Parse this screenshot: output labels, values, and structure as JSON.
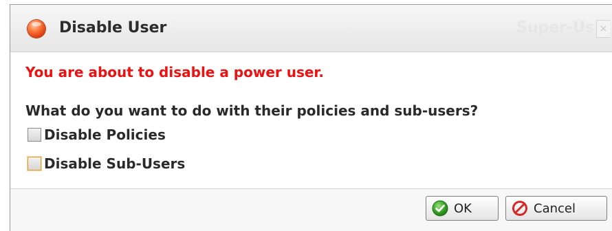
{
  "dialog": {
    "title": "Disable User",
    "background_title": "Super-Us",
    "close_label": "×"
  },
  "message": {
    "warning": "You are about to disable a power user.",
    "question": "What do you want to do with their policies and sub-users?"
  },
  "options": [
    {
      "label": "Disable Policies",
      "checked": false
    },
    {
      "label": "Disable Sub-Users",
      "checked": false,
      "focused": true
    }
  ],
  "buttons": {
    "ok_label": "OK",
    "cancel_label": "Cancel"
  },
  "icons": {
    "title": "record-icon",
    "ok": "check-circle-icon",
    "cancel": "no-entry-icon"
  },
  "colors": {
    "warning": "#ee1111",
    "title_icon": "#e8501e",
    "ok_icon": "#3aa52a",
    "cancel_icon": "#d92626"
  }
}
